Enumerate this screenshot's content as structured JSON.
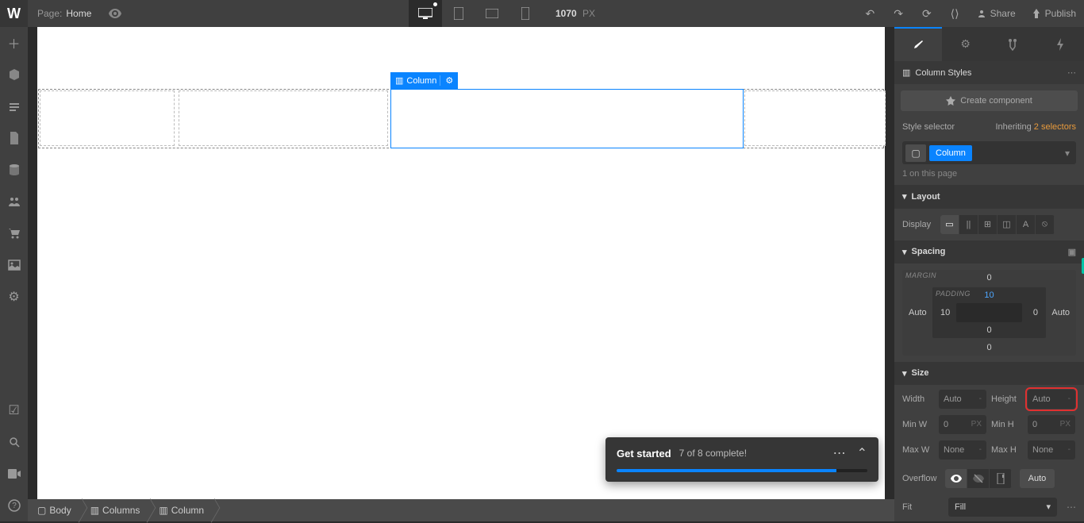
{
  "page": {
    "label": "Page:",
    "name": "Home"
  },
  "canvas": {
    "width": "1070",
    "unit": "PX"
  },
  "topActions": {
    "share": "Share",
    "publish": "Publish"
  },
  "selected": {
    "label": "Column"
  },
  "breadcrumb": [
    "Body",
    "Columns",
    "Column"
  ],
  "panel": {
    "title": "Column Styles",
    "createComponent": "Create component",
    "styleSelector": "Style selector",
    "inheriting": "Inheriting",
    "inheritCount": "2 selectors",
    "selectorTag": "Column",
    "onPage": "1 on this page"
  },
  "layout": {
    "title": "Layout",
    "display": "Display"
  },
  "spacing": {
    "title": "Spacing",
    "marginLabel": "MARGIN",
    "paddingLabel": "PADDING",
    "margin": {
      "top": "0",
      "right": "Auto",
      "bottom": "0",
      "left": "Auto"
    },
    "padding": {
      "top": "10",
      "right": "0",
      "bottom": "0",
      "left": "10"
    }
  },
  "size": {
    "title": "Size",
    "width": "Width",
    "widthVal": "Auto",
    "height": "Height",
    "heightVal": "Auto",
    "minW": "Min W",
    "minWVal": "0",
    "minWUnit": "PX",
    "minH": "Min H",
    "minHVal": "0",
    "minHUnit": "PX",
    "maxW": "Max W",
    "maxWVal": "None",
    "maxH": "Max H",
    "maxHVal": "None",
    "overflow": "Overflow",
    "auto": "Auto",
    "fit": "Fit",
    "fitVal": "Fill"
  },
  "toast": {
    "title": "Get started",
    "progress": "7 of 8 complete!",
    "percent": 87.5
  }
}
